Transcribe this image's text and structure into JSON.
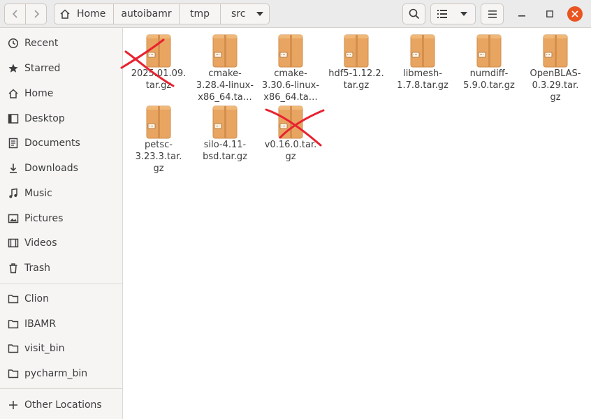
{
  "header": {
    "breadcrumbs": [
      "Home",
      "autoibamr",
      "tmp",
      "src"
    ]
  },
  "sidebar": {
    "places": [
      {
        "label": "Recent",
        "icon": "clock-icon"
      },
      {
        "label": "Starred",
        "icon": "star-icon"
      },
      {
        "label": "Home",
        "icon": "home-icon"
      },
      {
        "label": "Desktop",
        "icon": "desktop-icon"
      },
      {
        "label": "Documents",
        "icon": "document-icon"
      },
      {
        "label": "Downloads",
        "icon": "download-icon"
      },
      {
        "label": "Music",
        "icon": "music-icon"
      },
      {
        "label": "Pictures",
        "icon": "picture-icon"
      },
      {
        "label": "Videos",
        "icon": "video-icon"
      },
      {
        "label": "Trash",
        "icon": "trash-icon"
      }
    ],
    "bookmarks": [
      {
        "label": "Clion",
        "icon": "folder-icon"
      },
      {
        "label": "IBAMR",
        "icon": "folder-icon"
      },
      {
        "label": "visit_bin",
        "icon": "folder-icon"
      },
      {
        "label": "pycharm_bin",
        "icon": "folder-icon"
      }
    ],
    "other_locations": "Other Locations"
  },
  "files": [
    {
      "name": "2025.01.09.\ntar.gz",
      "crossed_out": true
    },
    {
      "name": "cmake-\n3.28.4-linux-\nx86_64.ta…",
      "crossed_out": false
    },
    {
      "name": "cmake-\n3.30.6-linux-\nx86_64.ta…",
      "crossed_out": false
    },
    {
      "name": "hdf5-1.12.2.\ntar.gz",
      "crossed_out": false
    },
    {
      "name": "libmesh-\n1.7.8.tar.gz",
      "crossed_out": false
    },
    {
      "name": "numdiff-\n5.9.0.tar.gz",
      "crossed_out": false
    },
    {
      "name": "OpenBLAS-\n0.3.29.tar.\ngz",
      "crossed_out": false
    },
    {
      "name": "petsc-\n3.23.3.tar.\ngz",
      "crossed_out": false
    },
    {
      "name": "silo-4.11-\nbsd.tar.gz",
      "crossed_out": false
    },
    {
      "name": "v0.16.0.tar.\ngz",
      "crossed_out": true
    }
  ],
  "colors": {
    "archive_icon": "#e8a561",
    "annotation_x": "#e8222f",
    "close_button": "#e95420"
  }
}
